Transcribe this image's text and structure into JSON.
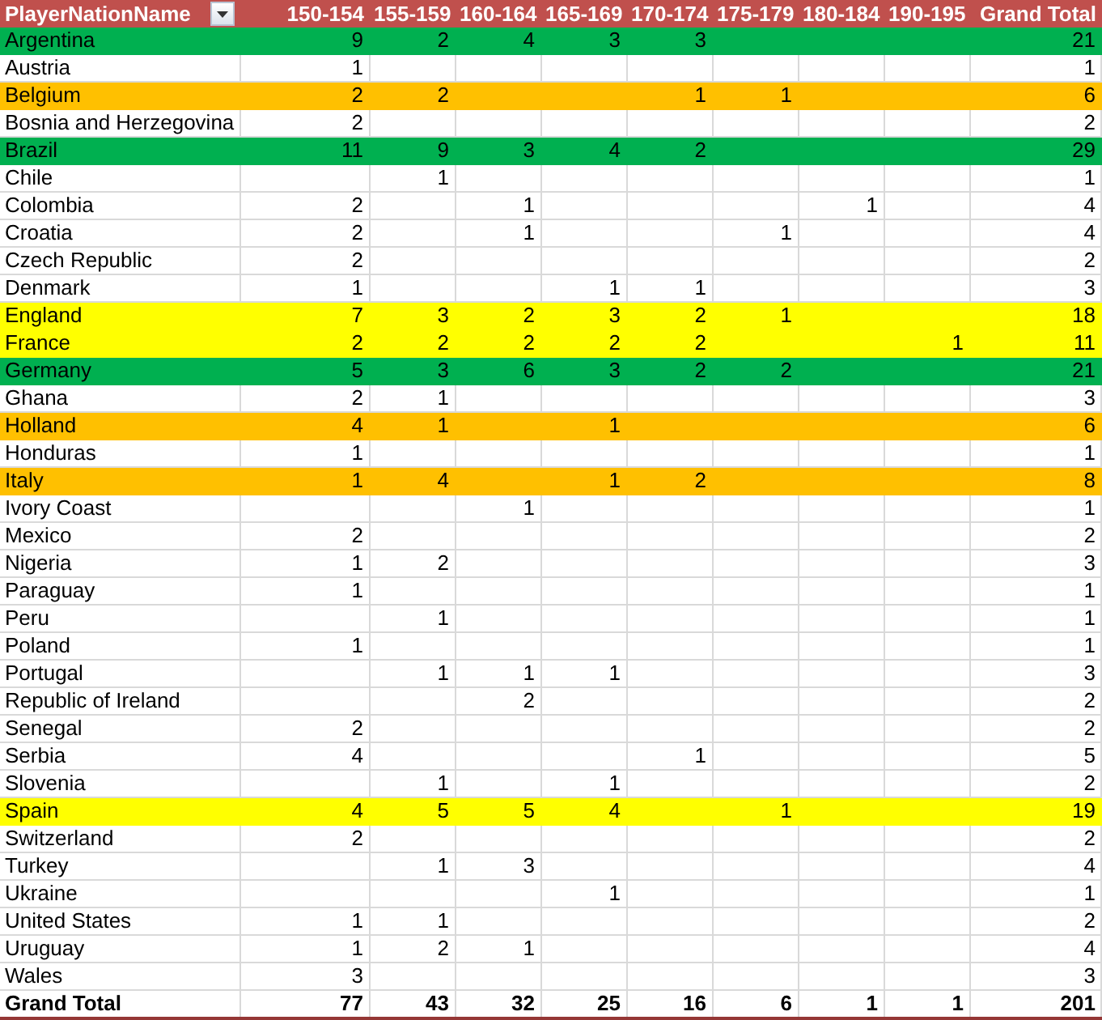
{
  "header": {
    "row_label": "PlayerNationName",
    "columns": [
      "150-154",
      "155-159",
      "160-164",
      "165-169",
      "170-174",
      "175-179",
      "180-184",
      "190-195"
    ],
    "total": "Grand Total"
  },
  "rows": [
    {
      "name": "Argentina",
      "values": {
        "col_1": "9",
        "col_2": "2",
        "col_3": "4",
        "col_4": "3",
        "col_5": "3"
      },
      "total": "21",
      "color": "#00b050"
    },
    {
      "name": "Austria",
      "values": {
        "col_1": "1"
      },
      "total": "1"
    },
    {
      "name": "Belgium",
      "values": {
        "col_1": "2",
        "col_2": "2",
        "col_5": "1",
        "col_6": "1"
      },
      "total": "6",
      "color": "#ffc000"
    },
    {
      "name": "Bosnia and Herzegovina",
      "values": {
        "col_1": "2"
      },
      "total": "2"
    },
    {
      "name": "Brazil",
      "values": {
        "col_1": "11",
        "col_2": "9",
        "col_3": "3",
        "col_4": "4",
        "col_5": "2"
      },
      "total": "29",
      "color": "#00b050"
    },
    {
      "name": "Chile",
      "values": {
        "col_2": "1"
      },
      "total": "1"
    },
    {
      "name": "Colombia",
      "values": {
        "col_1": "2",
        "col_3": "1",
        "col_7": "1"
      },
      "total": "4"
    },
    {
      "name": "Croatia",
      "values": {
        "col_1": "2",
        "col_3": "1",
        "col_6": "1"
      },
      "total": "4"
    },
    {
      "name": "Czech Republic",
      "values": {
        "col_1": "2"
      },
      "total": "2"
    },
    {
      "name": "Denmark",
      "values": {
        "col_1": "1",
        "col_4": "1",
        "col_5": "1"
      },
      "total": "3"
    },
    {
      "name": "England",
      "values": {
        "col_1": "7",
        "col_2": "3",
        "col_3": "2",
        "col_4": "3",
        "col_5": "2",
        "col_6": "1"
      },
      "total": "18",
      "color": "#ffff00"
    },
    {
      "name": "France",
      "values": {
        "col_1": "2",
        "col_2": "2",
        "col_3": "2",
        "col_4": "2",
        "col_5": "2",
        "col_8": "1"
      },
      "total": "11",
      "color": "#ffff00"
    },
    {
      "name": "Germany",
      "values": {
        "col_1": "5",
        "col_2": "3",
        "col_3": "6",
        "col_4": "3",
        "col_5": "2",
        "col_6": "2"
      },
      "total": "21",
      "color": "#00b050"
    },
    {
      "name": "Ghana",
      "values": {
        "col_1": "2",
        "col_2": "1"
      },
      "total": "3"
    },
    {
      "name": "Holland",
      "values": {
        "col_1": "4",
        "col_2": "1",
        "col_4": "1"
      },
      "total": "6",
      "color": "#ffc000"
    },
    {
      "name": "Honduras",
      "values": {
        "col_1": "1"
      },
      "total": "1"
    },
    {
      "name": "Italy",
      "values": {
        "col_1": "1",
        "col_2": "4",
        "col_4": "1",
        "col_5": "2"
      },
      "total": "8",
      "color": "#ffc000"
    },
    {
      "name": "Ivory Coast",
      "values": {
        "col_3": "1"
      },
      "total": "1"
    },
    {
      "name": "Mexico",
      "values": {
        "col_1": "2"
      },
      "total": "2"
    },
    {
      "name": "Nigeria",
      "values": {
        "col_1": "1",
        "col_2": "2"
      },
      "total": "3"
    },
    {
      "name": "Paraguay",
      "values": {
        "col_1": "1"
      },
      "total": "1"
    },
    {
      "name": "Peru",
      "values": {
        "col_2": "1"
      },
      "total": "1"
    },
    {
      "name": "Poland",
      "values": {
        "col_1": "1"
      },
      "total": "1"
    },
    {
      "name": "Portugal",
      "values": {
        "col_2": "1",
        "col_3": "1",
        "col_4": "1"
      },
      "total": "3"
    },
    {
      "name": "Republic of Ireland",
      "values": {
        "col_3": "2"
      },
      "total": "2"
    },
    {
      "name": "Senegal",
      "values": {
        "col_1": "2"
      },
      "total": "2"
    },
    {
      "name": "Serbia",
      "values": {
        "col_1": "4",
        "col_5": "1"
      },
      "total": "5"
    },
    {
      "name": "Slovenia",
      "values": {
        "col_2": "1",
        "col_4": "1"
      },
      "total": "2"
    },
    {
      "name": "Spain",
      "values": {
        "col_1": "4",
        "col_2": "5",
        "col_3": "5",
        "col_4": "4",
        "col_6": "1"
      },
      "total": "19",
      "color": "#ffff00"
    },
    {
      "name": "Switzerland",
      "values": {
        "col_1": "2"
      },
      "total": "2"
    },
    {
      "name": "Turkey",
      "values": {
        "col_2": "1",
        "col_3": "3"
      },
      "total": "4"
    },
    {
      "name": "Ukraine",
      "values": {
        "col_4": "1"
      },
      "total": "1"
    },
    {
      "name": "United States",
      "values": {
        "col_1": "1",
        "col_2": "1"
      },
      "total": "2"
    },
    {
      "name": "Uruguay",
      "values": {
        "col_1": "1",
        "col_2": "2",
        "col_3": "1"
      },
      "total": "4"
    },
    {
      "name": "Wales",
      "values": {
        "col_1": "3"
      },
      "total": "3"
    }
  ],
  "grand_total": {
    "label": "Grand Total",
    "values": [
      "77",
      "43",
      "32",
      "25",
      "16",
      "6",
      "1",
      "1"
    ],
    "total": "201"
  }
}
